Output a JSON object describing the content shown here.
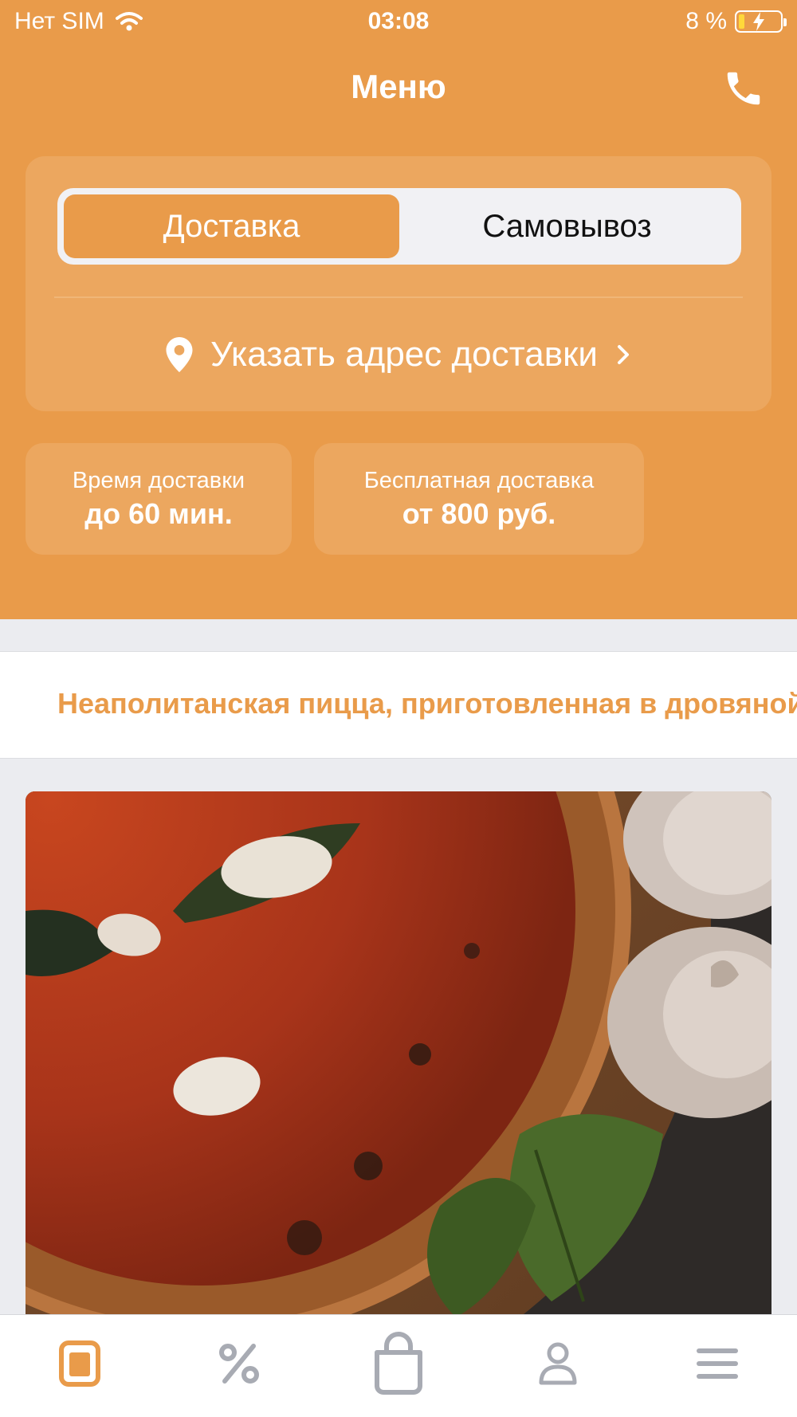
{
  "status_bar": {
    "carrier": "Нет SIM",
    "time": "03:08",
    "battery": "8 %"
  },
  "header": {
    "title": "Меню"
  },
  "delivery_mode": {
    "options": [
      {
        "label": "Доставка",
        "selected": true
      },
      {
        "label": "Самовывоз",
        "selected": false
      }
    ],
    "address_prompt": "Указать адрес доставки"
  },
  "info_cards": [
    {
      "label": "Время доставки",
      "value": "до 60 мин."
    },
    {
      "label": "Бесплатная доставка",
      "value": "от 800 руб."
    }
  ],
  "category": {
    "label": "Неаполитанская пицца, приготовленная в дровяной печи"
  },
  "tab_bar": {
    "tabs": [
      {
        "icon": "menu-icon",
        "active": true
      },
      {
        "icon": "percent-icon",
        "active": false
      },
      {
        "icon": "bag-icon",
        "active": false
      },
      {
        "icon": "profile-icon",
        "active": false
      },
      {
        "icon": "hamburger-icon",
        "active": false
      }
    ]
  },
  "colors": {
    "accent": "#e99b4a",
    "card": "#eca75f",
    "background": "#ebecf0",
    "inactive_icon": "#a8abb3"
  }
}
